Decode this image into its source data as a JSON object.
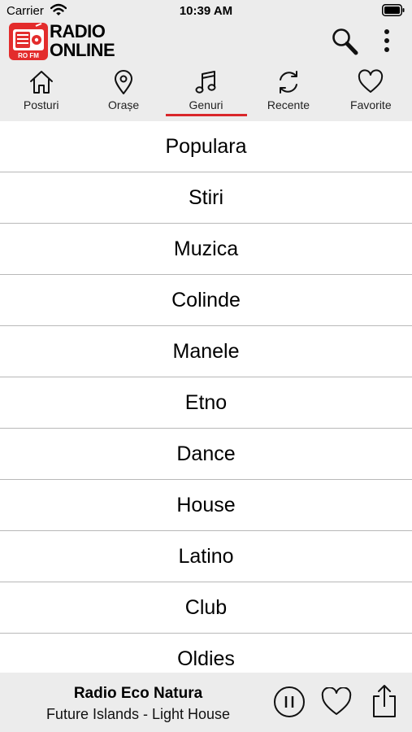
{
  "status": {
    "carrier": "Carrier",
    "time": "10:39 AM"
  },
  "header": {
    "logo_line1": "RADIO",
    "logo_line2": "ONLINE",
    "logo_badge": "RO FM",
    "brand_color": "#e32c2c"
  },
  "tabs": [
    {
      "label": "Posturi",
      "icon": "home-icon"
    },
    {
      "label": "Orașe",
      "icon": "location-pin-icon"
    },
    {
      "label": "Genuri",
      "icon": "music-note-icon",
      "active": true
    },
    {
      "label": "Recente",
      "icon": "refresh-icon"
    },
    {
      "label": "Favorite",
      "icon": "heart-icon"
    }
  ],
  "genres": [
    "Populara",
    "Stiri",
    "Muzica",
    "Colinde",
    "Manele",
    "Etno",
    "Dance",
    "House",
    "Latino",
    "Club",
    "Oldies"
  ],
  "player": {
    "station": "Radio Eco Natura",
    "track": "Future Islands - Light House",
    "state": "playing"
  },
  "colors": {
    "accent": "#d9262a",
    "bar_background": "#ececec",
    "divider": "#b8b8b8"
  }
}
